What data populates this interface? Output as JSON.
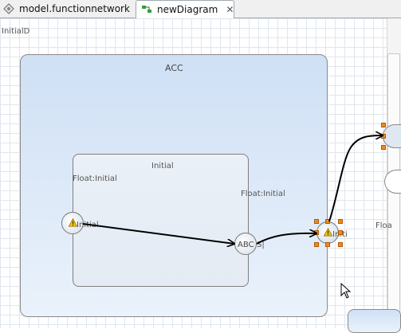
{
  "tabs": [
    {
      "label": "model.functionnetwork",
      "icon": "model-icon",
      "active": false
    },
    {
      "label": "newDiagram",
      "icon": "diagram-icon",
      "active": true,
      "close_icon": "close-icon"
    }
  ],
  "canvas": {
    "corner_label": "InitialD",
    "acc": {
      "title": "ACC"
    },
    "initial_box": {
      "title": "Initial"
    },
    "labels": {
      "float_initial_left": "Float:Initial",
      "float_initial_right": "Float:Initial",
      "port_initial_left": "Initial",
      "port_abc": "ABC",
      "port_abc_suffix": "S|",
      "port_right": "Initi",
      "float_clipped": "Floa"
    },
    "warning_icon": "warning-icon",
    "cursor_icon": "mouse-pointer-icon"
  },
  "colors": {
    "accent_orange": "#f08a1e",
    "container_blue": "#cfe0f5",
    "grid": "#dfe6ef"
  }
}
